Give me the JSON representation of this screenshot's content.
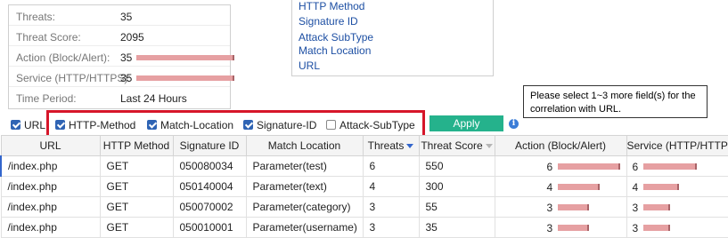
{
  "summary": {
    "threats_label": "Threats:",
    "threats_value": "35",
    "score_label": "Threat Score:",
    "score_value": "2095",
    "action_label": "Action (Block/Alert):",
    "action_value": "35",
    "action_fraction": 1.0,
    "service_label": "Service (HTTP/HTTPS):",
    "service_value": "35",
    "service_fraction": 1.0,
    "period_label": "Time Period:",
    "period_value": "Last 24 Hours"
  },
  "field_list": [
    "HTTP Method",
    "Signature ID",
    "Attack SubType",
    "Match Location",
    "URL"
  ],
  "tooltip": "Please select 1~3 more field(s) for the correlation with URL.",
  "filters": {
    "url": {
      "label": "URL",
      "checked": true
    },
    "http_method": {
      "label": "HTTP-Method",
      "checked": true
    },
    "match_location": {
      "label": "Match-Location",
      "checked": true
    },
    "signature_id": {
      "label": "Signature-ID",
      "checked": true
    },
    "attack_subtype": {
      "label": "Attack-SubType",
      "checked": false
    }
  },
  "apply_label": "Apply",
  "info_icon": "info-icon",
  "table": {
    "headers": [
      "URL",
      "HTTP Method",
      "Signature ID",
      "Match Location",
      "Threats",
      "Threat Score",
      "Action (Block/Alert)",
      "Service (HTTP/HTTPS)"
    ],
    "rows": [
      {
        "url": "/index.php",
        "method": "GET",
        "sig": "050080034",
        "loc": "Parameter(test)",
        "threats": "6",
        "score": "550",
        "action": "6",
        "action_fraction": 1.0,
        "service": "6",
        "service_fraction": 1.0
      },
      {
        "url": "/index.php",
        "method": "GET",
        "sig": "050140004",
        "loc": "Parameter(text)",
        "threats": "4",
        "score": "300",
        "action": "4",
        "action_fraction": 0.667,
        "service": "4",
        "service_fraction": 0.667
      },
      {
        "url": "/index.php",
        "method": "GET",
        "sig": "050070002",
        "loc": "Parameter(category)",
        "threats": "3",
        "score": "55",
        "action": "3",
        "action_fraction": 0.5,
        "service": "3",
        "service_fraction": 0.5
      },
      {
        "url": "/index.php",
        "method": "GET",
        "sig": "050010001",
        "loc": "Parameter(username)",
        "threats": "3",
        "score": "35",
        "action": "3",
        "action_fraction": 0.5,
        "service": "3",
        "service_fraction": 0.5
      }
    ]
  },
  "colors": {
    "bar": "#e6a0a2",
    "apply": "#25b28c",
    "link": "#1d4fa3",
    "highlight": "#d6162a"
  }
}
